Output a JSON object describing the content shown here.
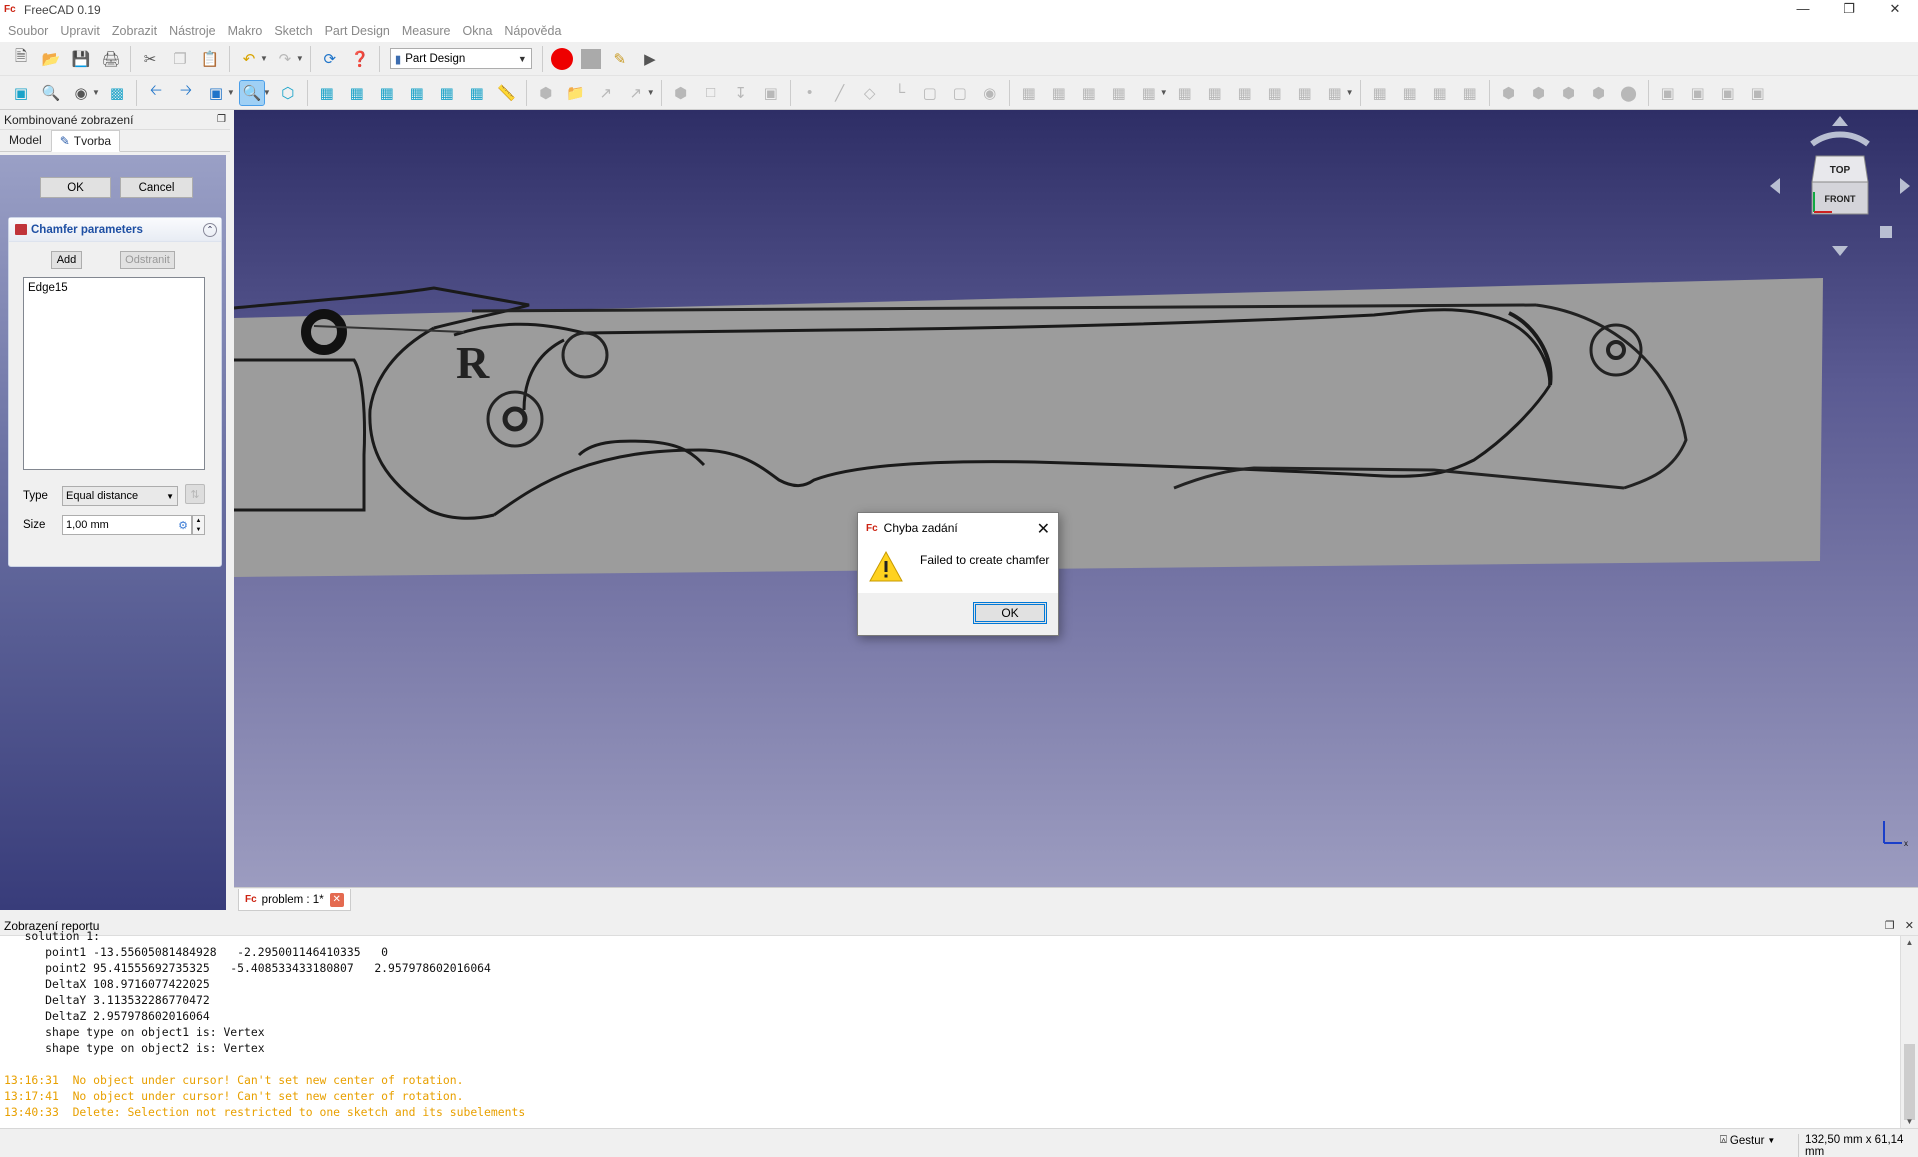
{
  "window": {
    "title": "FreeCAD 0.19",
    "icon": "freecad-icon",
    "controls": [
      "minimize",
      "restore",
      "close"
    ]
  },
  "menu": [
    "Soubor",
    "Upravit",
    "Zobrazit",
    "Nástroje",
    "Makro",
    "Sketch",
    "Part Design",
    "Measure",
    "Okna",
    "Nápověda"
  ],
  "toolbar": {
    "workbench": "Part Design"
  },
  "combo_view": {
    "title": "Kombinované zobrazení",
    "tabs": [
      "Model",
      "Tvorba"
    ],
    "active_tab": "Tvorba",
    "ok_label": "OK",
    "cancel_label": "Cancel",
    "chamfer": {
      "title": "Chamfer parameters",
      "add_label": "Add",
      "remove_label": "Odstranit",
      "edges": [
        "Edge15"
      ],
      "type_label": "Type",
      "type_value": "Equal distance",
      "size_label": "Size",
      "size_value": "1,00 mm"
    }
  },
  "navcube": {
    "top": "TOP",
    "front": "FRONT"
  },
  "axes": {
    "x": "x"
  },
  "doc_tab": {
    "label": "problem : 1*"
  },
  "report": {
    "title": "Zobrazení reportu",
    "lines": [
      {
        "text": "   solution 1:",
        "kind": "normal"
      },
      {
        "text": "      point1 -13.55605081484928   -2.295001146410335   0",
        "kind": "normal"
      },
      {
        "text": "      point2 95.41555692735325   -5.408533433180807   2.957978602016064",
        "kind": "normal"
      },
      {
        "text": "      DeltaX 108.9716077422025",
        "kind": "normal"
      },
      {
        "text": "      DeltaY 3.113532286770472",
        "kind": "normal"
      },
      {
        "text": "      DeltaZ 2.957978602016064",
        "kind": "normal"
      },
      {
        "text": "      shape type on object1 is: Vertex",
        "kind": "normal"
      },
      {
        "text": "      shape type on object2 is: Vertex",
        "kind": "normal"
      },
      {
        "text": "",
        "kind": "normal"
      },
      {
        "text": "13:16:31  No object under cursor! Can't set new center of rotation.",
        "kind": "warning"
      },
      {
        "text": "13:17:41  No object under cursor! Can't set new center of rotation.",
        "kind": "warning"
      },
      {
        "text": "13:40:33  Delete: Selection not restricted to one sketch and its subelements",
        "kind": "warning"
      }
    ]
  },
  "status": {
    "nav_style": "Gestur",
    "dimensions": "132,50 mm x 61,14 mm"
  },
  "dialog": {
    "title": "Chyba zadání",
    "message": "Failed to create chamfer",
    "ok_label": "OK",
    "icon": "warning-icon"
  },
  "colors": {
    "warning_text": "#e8a000",
    "accent": "#0078d7",
    "panel_title": "#1e4fa3"
  }
}
